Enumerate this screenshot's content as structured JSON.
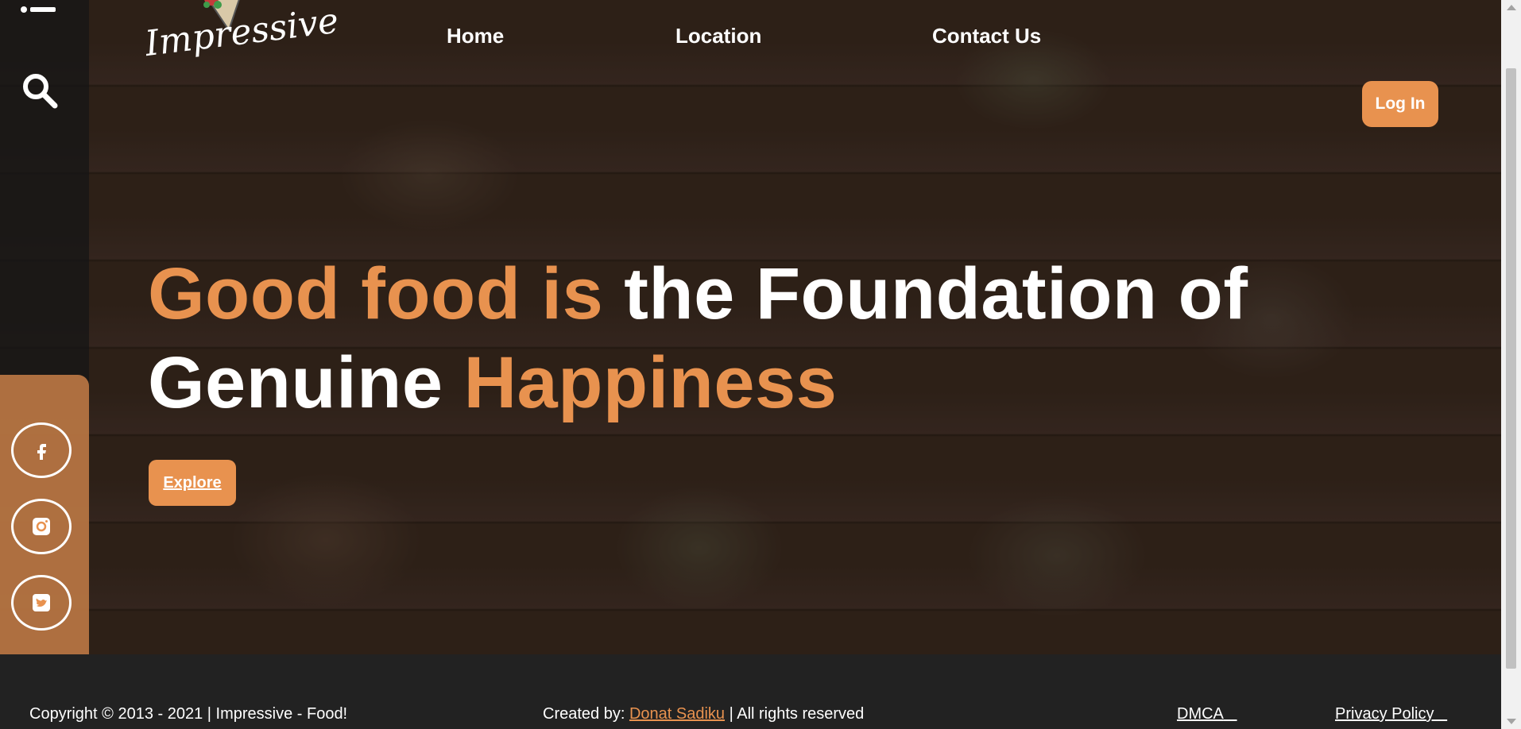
{
  "brand": {
    "logo_text": "Impressive"
  },
  "nav": {
    "home": "Home",
    "location": "Location",
    "contact": "Contact Us",
    "login": "Log In"
  },
  "hero": {
    "line1_accent": "Good food is",
    "line1_rest": " the Foundation of",
    "line2_start": "Genuine ",
    "line2_accent": "Happiness",
    "explore": "Explore"
  },
  "social": [
    {
      "icon": "facebook-icon"
    },
    {
      "icon": "instagram-icon"
    },
    {
      "icon": "twitter-icon"
    }
  ],
  "footer": {
    "copyright": "Copyright © 2013 - 2021 | Impressive - Food!",
    "created_prefix": "Created by: ",
    "author": "Donat Sadiku",
    "created_suffix": " | All rights reserved",
    "dmca": "DMCA",
    "privacy": "Privacy Policy"
  },
  "colors": {
    "accent": "#e8924f",
    "background": "#222222",
    "text": "#ffffff"
  }
}
